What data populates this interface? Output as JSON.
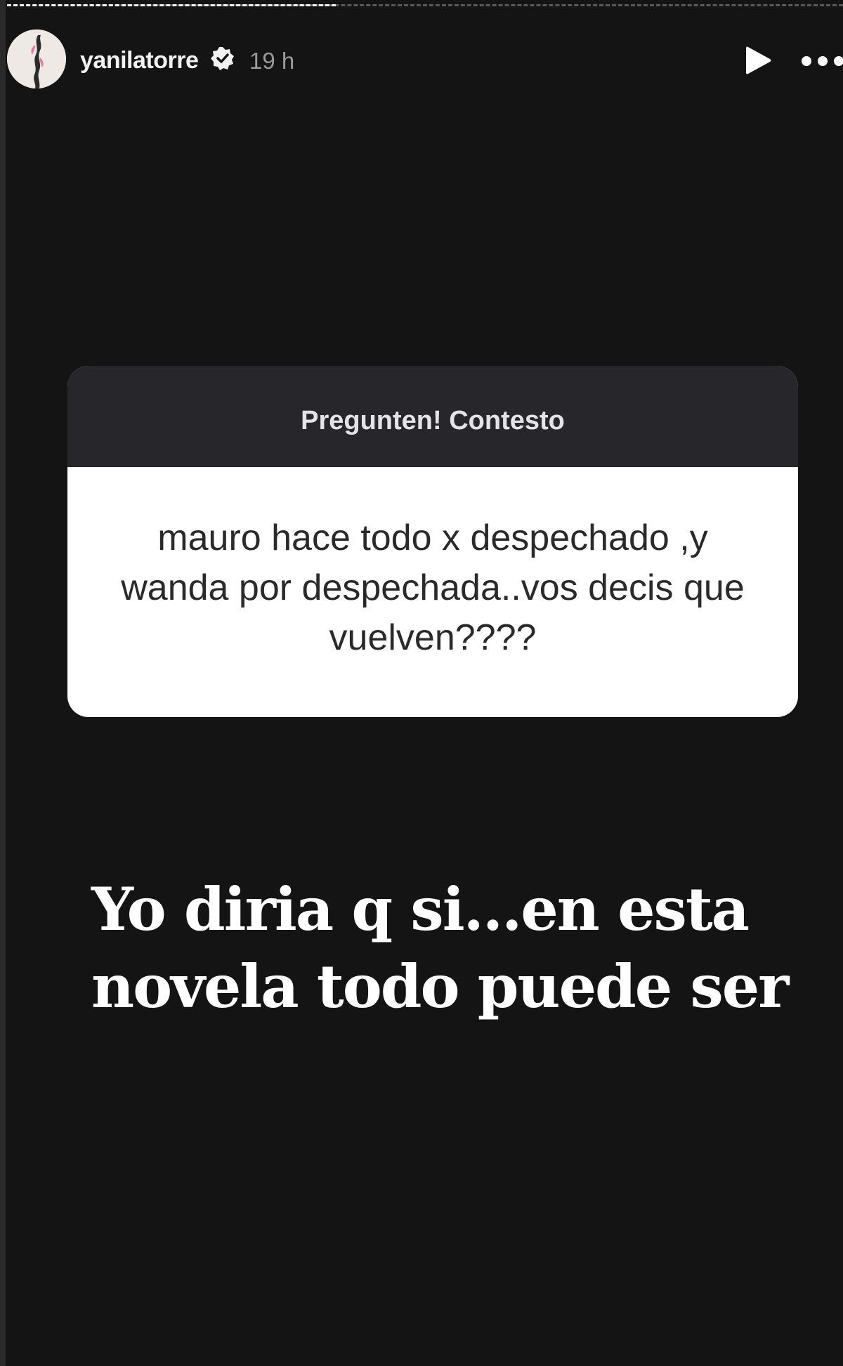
{
  "story": {
    "progress_segments": 2,
    "progress_current": 1,
    "header": {
      "username": "yanilatorre",
      "verified": true,
      "timestamp": "19 h",
      "icons": {
        "avatar": "profile-avatar",
        "verified": "verified-badge-icon",
        "play": "play-icon",
        "more": "more-options-icon"
      }
    },
    "question_sticker": {
      "title": "Pregunten! Contesto",
      "question": "mauro hace todo x despechado ,y wanda por despechada..vos decis que vuelven????"
    },
    "answer_text": "Yo diria q si...en esta novela todo puede ser"
  },
  "colors": {
    "background": "#141414",
    "sticker_header": "#26262b",
    "sticker_body": "#ffffff",
    "text_primary": "#ffffff",
    "text_muted": "#9a9a9a"
  }
}
